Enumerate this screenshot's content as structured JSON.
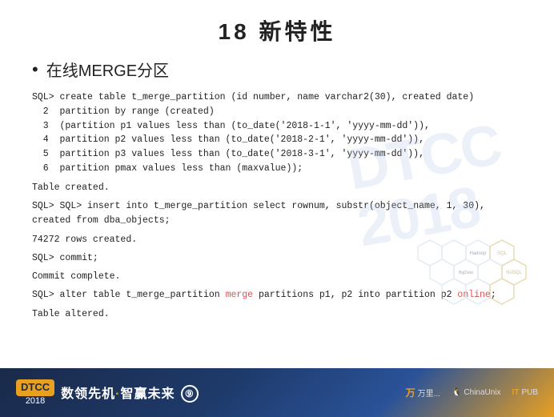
{
  "page": {
    "title": "18  新特性",
    "section": "在线MERGE分区",
    "bullet": "•",
    "watermark": "DTCC2018",
    "code_lines": [
      {
        "indent": "",
        "prompt": "SQL> ",
        "text": "create table t_merge_partition (id number, name varchar2(30), created date)"
      },
      {
        "indent": "  2 ",
        "prompt": "",
        "text": "  partition by range (created)"
      },
      {
        "indent": "  3 ",
        "prompt": "",
        "text": "  (partition p1 values less than (to_date('2018-1-1', 'yyyy-mm-dd')),"
      },
      {
        "indent": "  4 ",
        "prompt": "",
        "text": "   partition p2 values less than (to_date('2018-2-1', 'yyyy-mm-dd')),"
      },
      {
        "indent": "  5 ",
        "prompt": "",
        "text": "   partition p3 values less than (to_date('2018-3-1', 'yyyy-mm-dd')),"
      },
      {
        "indent": "  6 ",
        "prompt": "",
        "text": "   partition pmax values less than (maxvalue));"
      }
    ],
    "result1": "Table created.",
    "code2": "SQL> insert into t_merge_partition select rownum, substr(object_name, 1, 30), created from dba_objects;",
    "result2": "74272 rows created.",
    "code3": "SQL> commit;",
    "result3": "Commit complete.",
    "code4_prefix": "SQL> alter table t_merge_partition ",
    "code4_merge": "merge",
    "code4_mid": " partitions p1, p2 into partition p2 ",
    "code4_online": "online",
    "code4_suffix": ";",
    "result4": "Table altered.",
    "footer": {
      "badge": "DTCC",
      "year": "2018",
      "slogan": "数领先机·智赢未来",
      "circle_icon": "⑨",
      "sponsors": [
        {
          "name": "万里开源",
          "mark": "万里..."
        },
        {
          "name": "ChinaUnix",
          "mark": "ChinaUnix"
        },
        {
          "name": "ITPUB",
          "mark": "ITPUB"
        }
      ]
    },
    "hex_labels": [
      "Hadoop",
      "SQL",
      "BigData",
      "NoSQL"
    ]
  }
}
